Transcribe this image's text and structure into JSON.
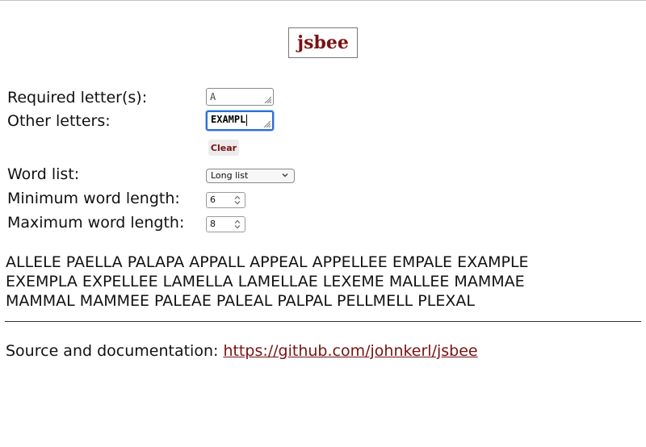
{
  "app": {
    "title": "jsbee"
  },
  "form": {
    "required_label": "Required letter(s):",
    "required_value": "A",
    "other_label": "Other letters:",
    "other_value": "EXAMPL",
    "clear_label": "Clear",
    "wordlist_label": "Word list:",
    "wordlist_selected": "Long list",
    "min_label": "Minimum word length:",
    "min_value": "6",
    "max_label": "Maximum word length:",
    "max_value": "8"
  },
  "results": {
    "lines": [
      "ALLELE PAELLA PALAPA APPALL APPEAL APPELLEE EMPALE EXAMPLE",
      "EXEMPLA EXPELLEE LAMELLA LAMELLAE LEXEME MALLEE MAMMAE",
      "MAMMAL MAMMEE PALEAE PALEAL PALPAL PELLMELL PLEXAL"
    ]
  },
  "footer": {
    "prefix": "Source and documentation:",
    "link_text": "https://github.com/johnkerl/jsbee"
  },
  "colors": {
    "brand": "#7a1212",
    "focus": "#2a6fd9"
  }
}
